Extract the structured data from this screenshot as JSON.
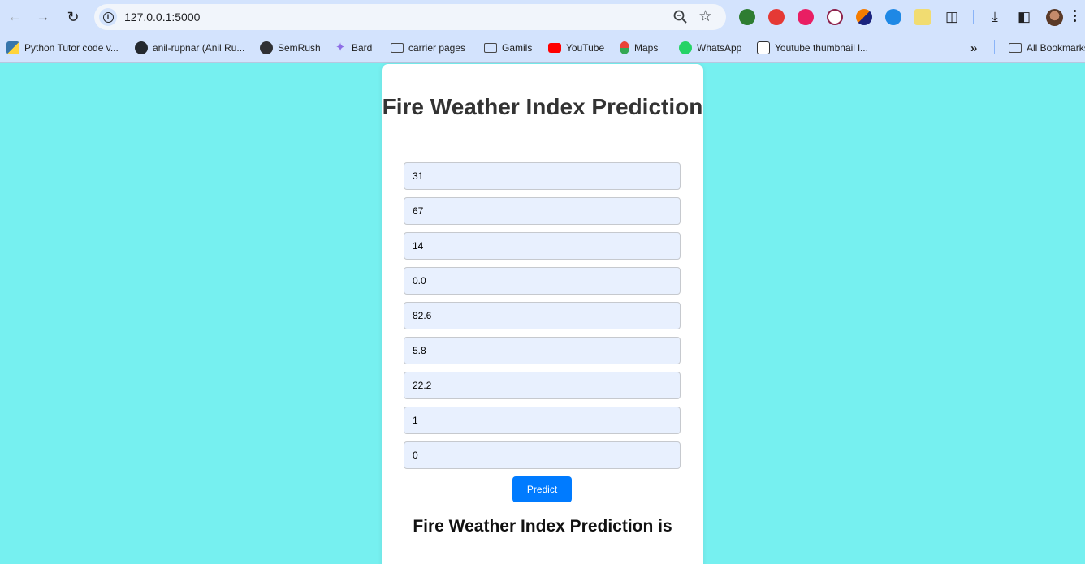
{
  "browser": {
    "url": "127.0.0.1:5000",
    "bookmarks": [
      {
        "label": "Python Tutor code v...",
        "icon": "python-icon"
      },
      {
        "label": "anil-rupnar (Anil Ru...",
        "icon": "github-icon"
      },
      {
        "label": "SemRush",
        "icon": "globe-icon"
      },
      {
        "label": "Bard",
        "icon": "sparkle-icon"
      },
      {
        "label": "carrier pages",
        "icon": "folder-icon"
      },
      {
        "label": "Gamils",
        "icon": "folder-icon"
      },
      {
        "label": "YouTube",
        "icon": "youtube-icon"
      },
      {
        "label": "Maps",
        "icon": "maps-icon"
      },
      {
        "label": "WhatsApp",
        "icon": "whatsapp-icon"
      },
      {
        "label": "Youtube thumbnail l...",
        "icon": "thumbnail-icon"
      }
    ],
    "all_bookmarks_label": "All Bookmarks"
  },
  "page": {
    "title": "Fire Weather Index Prediction",
    "fields": [
      "31",
      "67",
      "14",
      "0.0",
      "82.6",
      "5.8",
      "22.2",
      "1",
      "0"
    ],
    "predict_label": "Predict",
    "result_text": "Fire Weather Index Prediction is"
  },
  "colors": {
    "background": "#76f0f0",
    "button": "#007bff",
    "input_bg": "#e8f0fe"
  }
}
